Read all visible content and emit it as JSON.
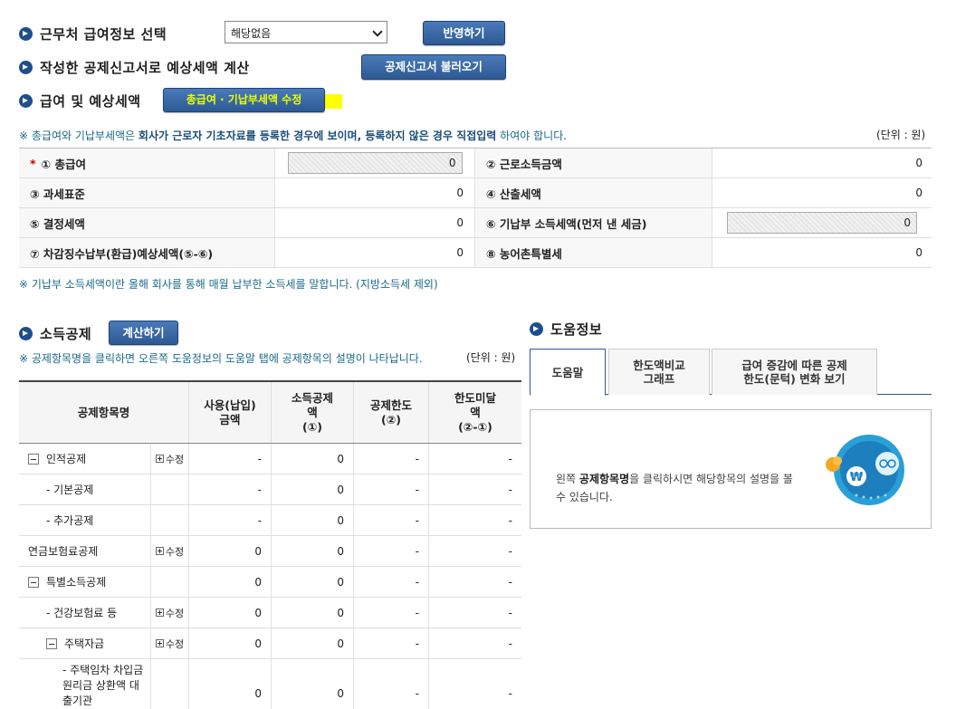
{
  "section1": {
    "title": "근무처 급여정보 선택",
    "select_value": "해당없음",
    "apply_button": "반영하기"
  },
  "section2": {
    "title": "작성한 공제신고서로 예상세액 계산",
    "load_button": "공제신고서 불러오기"
  },
  "section3": {
    "title": "급여 및 예상세액",
    "edit_button": "총급여 · 기납부세액 수정"
  },
  "notice1": {
    "prefix": "※ 총급여와 기납부세액은 ",
    "bold": "회사가 근로자 기초자료를 등록한 경우에 보이며, 등록하지 않은 경우 직접입력",
    "suffix": " 하여야 합니다."
  },
  "unit_label": "(단위 : 원)",
  "salary_rows": [
    {
      "l1": "① 총급여",
      "v1": "0",
      "l2": "② 근로소득금액",
      "v2": "0"
    },
    {
      "l1": "③ 과세표준",
      "v1": "0",
      "l2": "④ 산출세액",
      "v2": "0"
    },
    {
      "l1": "⑤ 결정세액",
      "v1": "0",
      "l2": "⑥ 기납부 소득세액(먼저 낸 세금)",
      "v2": "0"
    },
    {
      "l1": "⑦ 차감징수납부(환급)예상세액(⑤-⑥)",
      "v1": "0",
      "l2": "⑧ 농어촌특별세",
      "v2": "0"
    }
  ],
  "required_mark": "*",
  "notice2": "※ 기납부 소득세액이란 올해 회사를 통해 매월 납부한 소득세를 말합니다. (지방소득세 제외)",
  "deduction": {
    "title": "소득공제",
    "calc_button": "계산하기",
    "notice": "※ 공제항목명을 클릭하면 오른쪽 도움정보의 도움말 탭에 공제항목의 설명이 나타납니다.",
    "unit": "(단위 : 원)",
    "headers": [
      "공제항목명",
      "사용(납입)\n금액",
      "소득공제\n액\n(①)",
      "공제한도\n(②)",
      "한도미달\n액\n(②-①)"
    ],
    "rows": [
      {
        "name": "인적공제",
        "edit": "수정",
        "used": "-",
        "ded": "0",
        "limit": "-",
        "remain": "-"
      },
      {
        "name": "- 기본공제",
        "edit": "",
        "used": "-",
        "ded": "0",
        "limit": "-",
        "remain": "-"
      },
      {
        "name": "- 추가공제",
        "edit": "",
        "used": "-",
        "ded": "0",
        "limit": "-",
        "remain": "-"
      },
      {
        "name": "연금보험료공제",
        "edit": "수정",
        "used": "0",
        "ded": "0",
        "limit": "-",
        "remain": "-"
      },
      {
        "name": "특별소득공제",
        "edit": "",
        "used": "0",
        "ded": "0",
        "limit": "-",
        "remain": "-"
      },
      {
        "name": "- 건강보험료 등",
        "edit": "수정",
        "used": "0",
        "ded": "0",
        "limit": "-",
        "remain": "-"
      },
      {
        "name": "주택자금",
        "edit": "수정",
        "used": "0",
        "ded": "0",
        "limit": "-",
        "remain": "-"
      },
      {
        "name": "- 주택임차 차입금 원리금 상환액 대출기관",
        "edit": "",
        "used": "0",
        "ded": "0",
        "limit": "-",
        "remain": "-"
      }
    ]
  },
  "help": {
    "title": "도움정보",
    "tabs": [
      "도움말",
      "한도액비교\n그래프",
      "급여 증감에 따른 공제\n한도(문턱) 변화 보기"
    ],
    "text_prefix": "왼쪽 ",
    "text_bold": "공제항목명",
    "text_suffix": "을 클릭하시면 해당항목의 설명을 볼 수 있습니다."
  },
  "colors": {
    "accent": "#2d5a94",
    "highlight": "#ffff00",
    "notice": "#1a6a8a"
  },
  "icons": {
    "bullet": "arrow-bullet-icon",
    "collapse": "minus-box-icon",
    "expand": "plus-box-icon",
    "mascot": "won-mascot-icon"
  }
}
